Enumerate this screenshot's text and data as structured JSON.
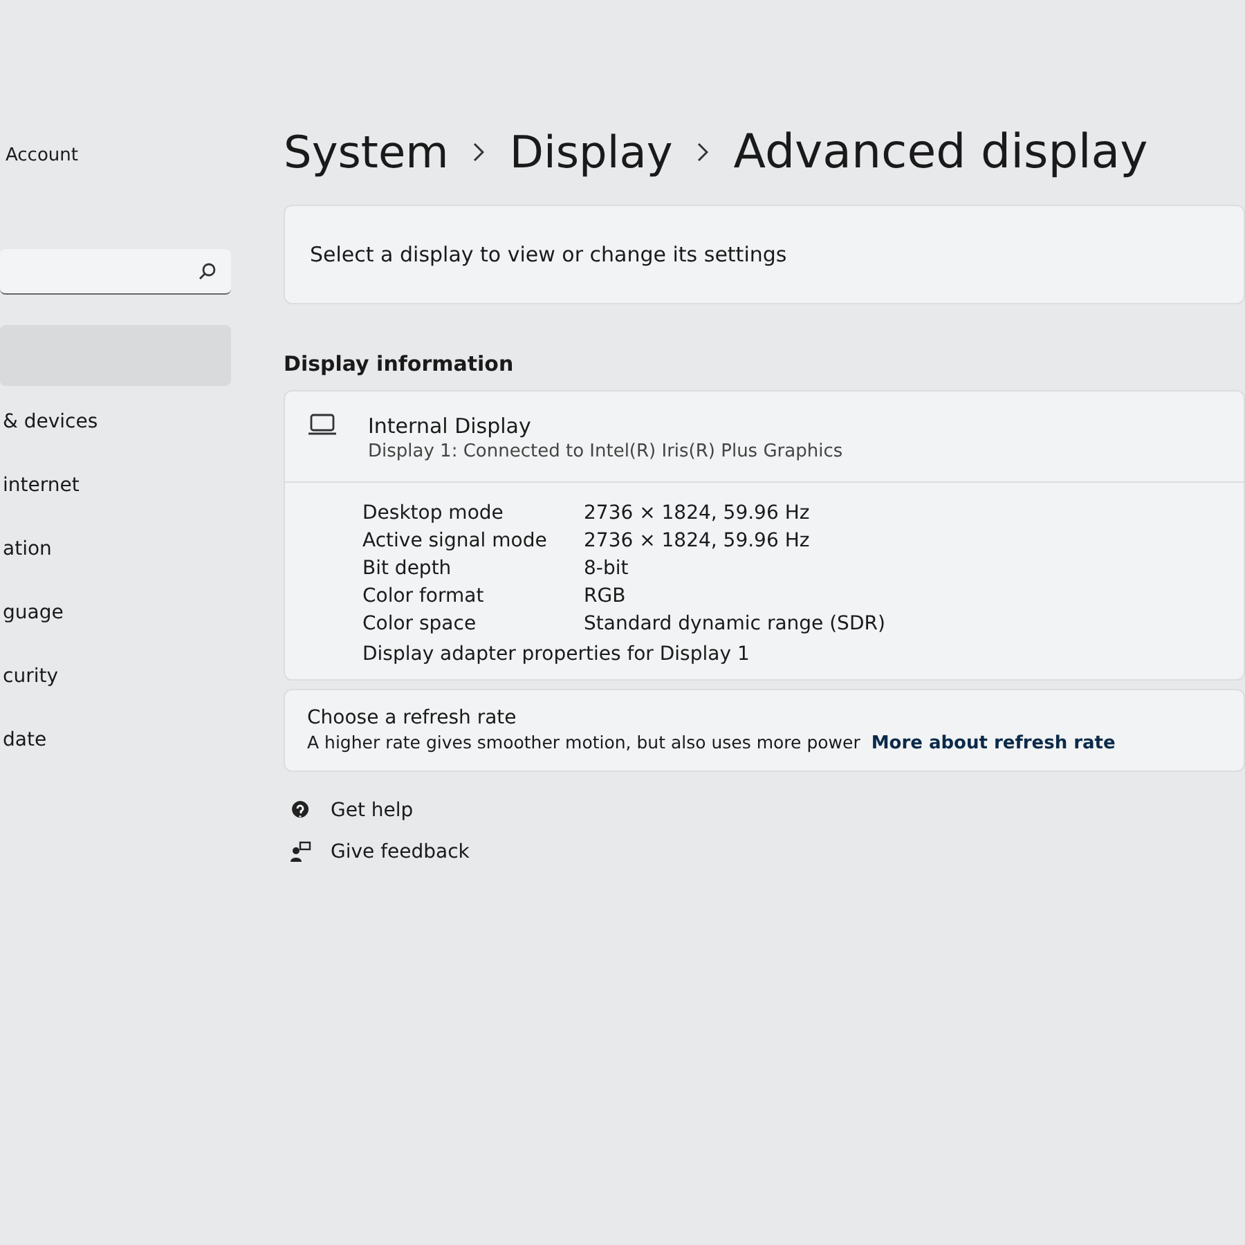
{
  "account": {
    "label": "Account"
  },
  "sidebar": {
    "items": [
      {
        "selected": true
      },
      {
        "label": "& devices",
        "selected": false
      },
      {
        "label": "internet",
        "selected": false
      },
      {
        "label": "ation",
        "selected": false
      },
      {
        "label": "guage",
        "selected": false
      },
      {
        "label": "curity",
        "selected": false
      },
      {
        "label": "date",
        "selected": false
      }
    ]
  },
  "breadcrumb": [
    "System",
    "Display",
    "Advanced display"
  ],
  "select_display": {
    "label": "Select a display to view or change its settings"
  },
  "section_title": "Display information",
  "display": {
    "name": "Internal Display",
    "subtitle": "Display 1: Connected to Intel(R) Iris(R) Plus Graphics",
    "properties": [
      {
        "label": "Desktop mode",
        "value": "2736 × 1824, 59.96 Hz"
      },
      {
        "label": "Active signal mode",
        "value": "2736 × 1824, 59.96 Hz"
      },
      {
        "label": "Bit depth",
        "value": "8-bit"
      },
      {
        "label": "Color format",
        "value": "RGB"
      },
      {
        "label": "Color space",
        "value": "Standard dynamic range (SDR)"
      }
    ],
    "adapter_link": "Display adapter properties for Display 1"
  },
  "refresh": {
    "title": "Choose a refresh rate",
    "description": "A higher rate gives smoother motion, but also uses more power",
    "link": "More about refresh rate"
  },
  "footer_links": [
    {
      "kind": "help",
      "label": "Get help"
    },
    {
      "kind": "feedback",
      "label": "Give feedback"
    }
  ]
}
